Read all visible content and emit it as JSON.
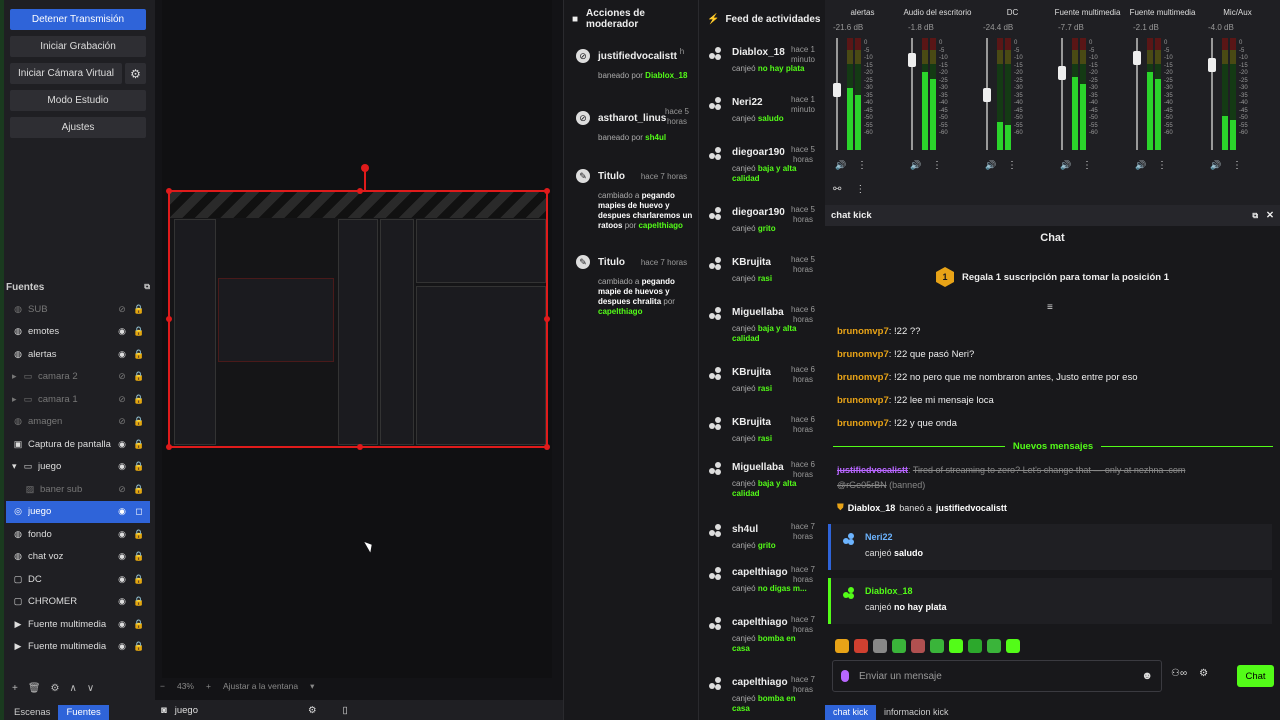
{
  "controls": {
    "stop_stream": "Detener Transmisión",
    "start_recording": "Iniciar Grabación",
    "start_virtual_cam": "Iniciar Cámara Virtual",
    "studio_mode": "Modo Estudio",
    "settings": "Ajustes"
  },
  "sources": {
    "header": "Fuentes",
    "items": [
      {
        "name": "SUB",
        "icon": "globe-icon",
        "dim": true
      },
      {
        "name": "emotes",
        "icon": "globe-icon",
        "dim": false
      },
      {
        "name": "alertas",
        "icon": "globe-icon",
        "dim": false
      },
      {
        "name": "camara 2",
        "icon": "folder-icon",
        "dim": true
      },
      {
        "name": "camara 1",
        "icon": "folder-icon",
        "dim": true
      },
      {
        "name": "amagen",
        "icon": "globe-icon",
        "dim": true
      },
      {
        "name": "Captura de pantalla",
        "icon": "monitor-icon",
        "dim": false
      },
      {
        "name": "juego",
        "icon": "folder-icon",
        "dim": false
      },
      {
        "name": "baner sub",
        "icon": "image-icon",
        "dim": true
      },
      {
        "name": "juego",
        "icon": "game-icon",
        "dim": false
      },
      {
        "name": "fondo",
        "icon": "globe-icon",
        "dim": false
      },
      {
        "name": "chat voz",
        "icon": "globe-icon",
        "dim": false
      },
      {
        "name": "DC",
        "icon": "window-icon",
        "dim": false
      },
      {
        "name": "CHROMER",
        "icon": "window-icon",
        "dim": false
      },
      {
        "name": "Fuente multimedia",
        "icon": "play-icon",
        "dim": false
      },
      {
        "name": "Fuente multimedia",
        "icon": "play-icon",
        "dim": false
      }
    ]
  },
  "left_tabs": {
    "scenes": "Escenas",
    "sources": "Fuentes"
  },
  "preview": {
    "zoom": "43%",
    "fit": "Ajustar a la ventana",
    "scene_name": "juego"
  },
  "mod_actions": {
    "title": "Acciones de moderador",
    "items": [
      {
        "user": "justifiedvocalistt",
        "time": "h",
        "action": "baneado por",
        "by": "Diablox_18"
      },
      {
        "user": "astharot_linus",
        "time": "hace 5 horas",
        "action": "baneado por",
        "by": "sh4ul"
      },
      {
        "user": "Titulo",
        "time": "hace 7 horas",
        "action": "cambiado a",
        "value": "pegando mapies de huevo y despues charlaremos un ratoos",
        "by_label": "por",
        "by": "capelthiago"
      },
      {
        "user": "Titulo",
        "time": "hace 7 horas",
        "action": "cambiado a",
        "value": "pegando mapie de huevos y despues chralita",
        "by_label": "por",
        "by": "capelthiago"
      }
    ]
  },
  "activity_feed": {
    "title": "Feed de actividades",
    "items": [
      {
        "user": "Diablox_18",
        "time": "hace 1 minuto",
        "action": "canjeó",
        "reward": "no hay plata"
      },
      {
        "user": "Neri22",
        "time": "hace 1 minuto",
        "action": "canjeó",
        "reward": "saludo"
      },
      {
        "user": "diegoar190",
        "time": "hace 5 horas",
        "action": "canjeó",
        "reward": "baja y alta calidad"
      },
      {
        "user": "diegoar190",
        "time": "hace 5 horas",
        "action": "canjeó",
        "reward": "grito"
      },
      {
        "user": "KBrujita",
        "time": "hace 5 horas",
        "action": "canjeó",
        "reward": "rasi"
      },
      {
        "user": "Miguellaba",
        "time": "hace 6 horas",
        "action": "canjeó",
        "reward": "baja y alta calidad"
      },
      {
        "user": "KBrujita",
        "time": "hace 6 horas",
        "action": "canjeó",
        "reward": "rasi"
      },
      {
        "user": "KBrujita",
        "time": "hace 6 horas",
        "action": "canjeó",
        "reward": "rasi"
      },
      {
        "user": "Miguellaba",
        "time": "hace 6 horas",
        "action": "canjeó",
        "reward": "baja y alta calidad"
      },
      {
        "user": "sh4ul",
        "time": "hace 7 horas",
        "action": "canjeó",
        "reward": "grito"
      },
      {
        "user": "capelthiago",
        "time": "hace 7 horas",
        "action": "canjeó",
        "reward": "no digas m..."
      },
      {
        "user": "capelthiago",
        "time": "hace 7 horas",
        "action": "canjeó",
        "reward": "bomba en casa"
      },
      {
        "user": "capelthiago",
        "time": "hace 7 horas",
        "action": "canjeó",
        "reward": "bomba en casa"
      }
    ]
  },
  "mixer": {
    "channels": [
      {
        "name": "alertas",
        "db": "-21.6 dB",
        "level": 0.55,
        "fader": 0.55
      },
      {
        "name": "Audio del escritorio",
        "db": "-1.8 dB",
        "level": 0.7,
        "fader": 0.85
      },
      {
        "name": "DC",
        "db": "-24.4 dB",
        "level": 0.25,
        "fader": 0.5
      },
      {
        "name": "Fuente multimedia",
        "db": "-7.7 dB",
        "level": 0.65,
        "fader": 0.72
      },
      {
        "name": "Fuente multimedia",
        "db": "-2.1 dB",
        "level": 0.7,
        "fader": 0.87
      },
      {
        "name": "Mic/Aux",
        "db": "-4.0 dB",
        "level": 0.3,
        "fader": 0.8
      }
    ],
    "scale": [
      "0",
      "-5",
      "-10",
      "-15",
      "-20",
      "-25",
      "-30",
      "-35",
      "-40",
      "-45",
      "-50",
      "-55",
      "-60"
    ]
  },
  "chat": {
    "dock_title": "chat kick",
    "title": "Chat",
    "sub_promo_rank": "1",
    "sub_promo": "Regala 1 suscripción para tomar la posición 1",
    "messages": [
      {
        "user": "brunomvp7",
        "text": "!22 ??"
      },
      {
        "user": "brunomvp7",
        "text": "!22 que pasó Neri?"
      },
      {
        "user": "brunomvp7",
        "text": "!22 no pero que me nombraron antes, Justo entre por eso"
      },
      {
        "user": "brunomvp7",
        "text": "!22 lee mi mensaje loca"
      },
      {
        "user": "brunomvp7",
        "text": "!22 y que onda"
      }
    ],
    "new_messages": "Nuevos mensajes",
    "banned_user": "justifiedvocalistt",
    "banned_text": "Tired of streaming to zero? Let's change that — only at nezhna .com",
    "banned_text2": "@rGe05rBN",
    "banned_label": "(banned)",
    "ban_note_by": "Diablox_18",
    "ban_note_action": "baneó a",
    "ban_note_target": "justifiedvocalistt",
    "redeems": [
      {
        "user": "Neri22",
        "action": "canjeó",
        "reward": "saludo"
      },
      {
        "user": "Diablox_18",
        "action": "canjeó",
        "reward": "no hay plata"
      }
    ],
    "input_placeholder": "Enviar un mensaje",
    "send_label": "Chat",
    "tabs": [
      "chat kick",
      "informacion kick"
    ]
  }
}
